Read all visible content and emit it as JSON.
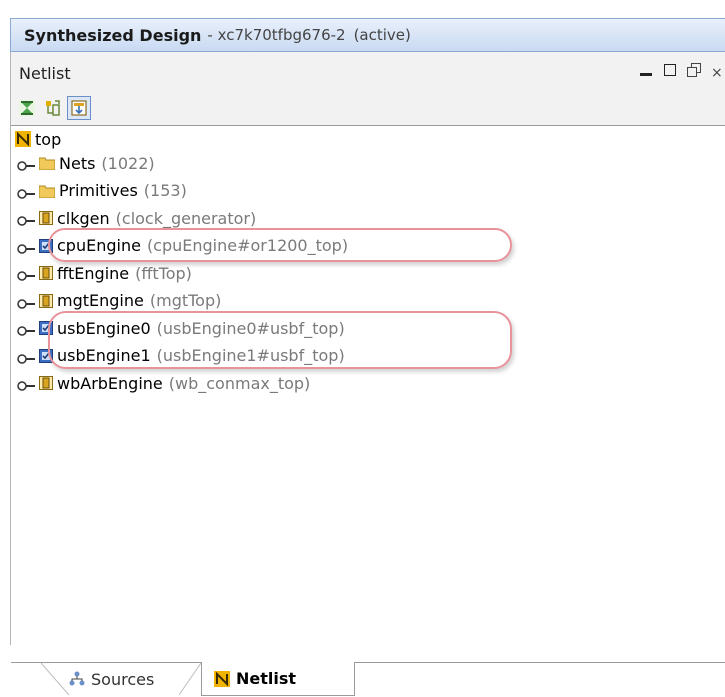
{
  "design": {
    "title": "Synthesized Design",
    "part": "- xc7k70tfbg676-2",
    "status": "(active)"
  },
  "panel": {
    "title": "Netlist",
    "controls": {
      "minimize": "minimize-icon",
      "maximize": "maximize-icon",
      "restore": "restore-icon",
      "close": "×"
    }
  },
  "toolbar": {
    "buttons": [
      {
        "icon": "collapse-all-icon"
      },
      {
        "icon": "expand-all-icon"
      },
      {
        "icon": "show-selected-icon",
        "pressed": true
      }
    ]
  },
  "tree": {
    "root": {
      "label": "top",
      "icon": "netlist-root-icon"
    },
    "items": [
      {
        "label": "Nets",
        "detail": "(1022)",
        "icon": "folder-icon"
      },
      {
        "label": "Primitives",
        "detail": "(153)",
        "icon": "folder-icon"
      },
      {
        "label": "clkgen",
        "detail": "(clock_generator)",
        "icon": "cell-icon"
      },
      {
        "label": "cpuEngine",
        "detail": "(cpuEngine#or1200_top)",
        "icon": "black-box-icon",
        "highlighted": true
      },
      {
        "label": "fftEngine",
        "detail": "(fftTop)",
        "icon": "cell-icon"
      },
      {
        "label": "mgtEngine",
        "detail": "(mgtTop)",
        "icon": "cell-icon"
      },
      {
        "label": "usbEngine0",
        "detail": "(usbEngine0#usbf_top)",
        "icon": "black-box-icon",
        "highlighted": true
      },
      {
        "label": "usbEngine1",
        "detail": "(usbEngine1#usbf_top)",
        "icon": "black-box-icon",
        "highlighted": true
      },
      {
        "label": "wbArbEngine",
        "detail": "(wb_conmax_top)",
        "icon": "cell-icon"
      }
    ]
  },
  "tabs": [
    {
      "label": "Sources",
      "icon": "hierarchy-icon",
      "active": false
    },
    {
      "label": "Netlist",
      "icon": "netlist-icon",
      "active": true
    }
  ],
  "colors": {
    "header_gradient_top": "#e8f0fb",
    "header_gradient_bottom": "#c9daf2",
    "highlight_outline": "#e8939a",
    "detail_text": "#7a7a7a",
    "folder": "#f0c95a",
    "cell_icon": "#d9a520",
    "black_box_icon": "#3c6fc4"
  }
}
